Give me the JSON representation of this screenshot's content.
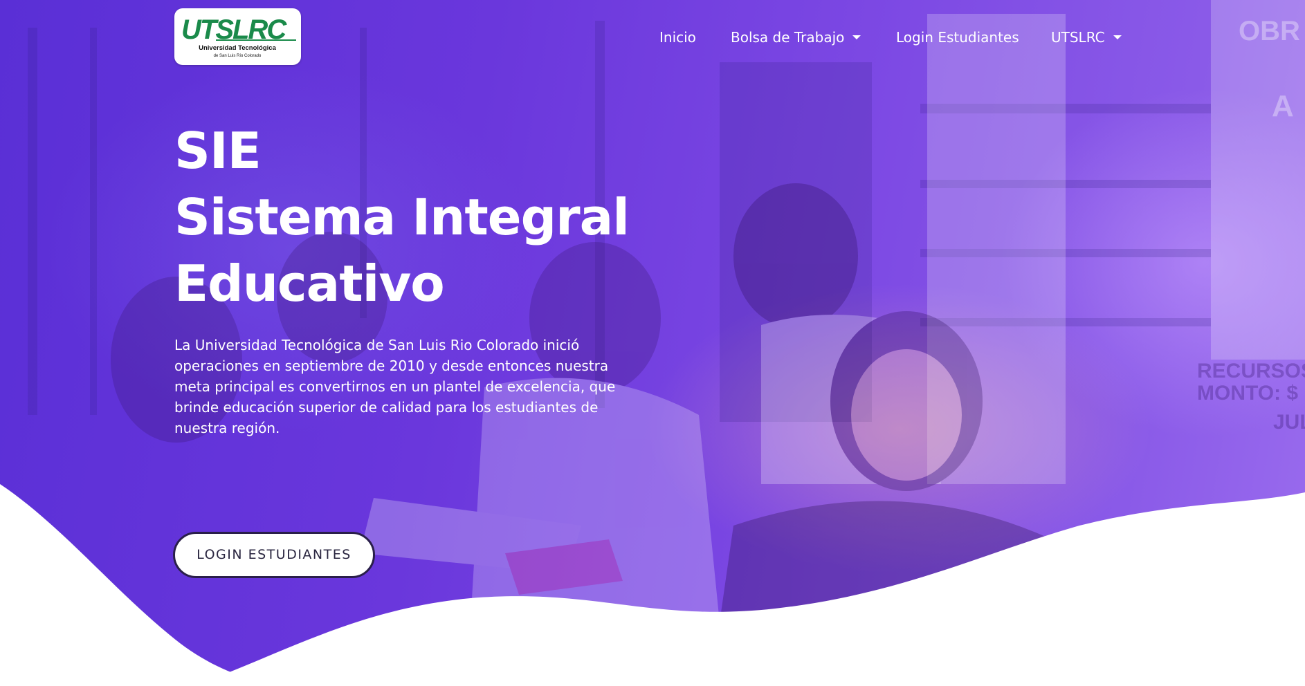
{
  "brand": {
    "logo_text": "UTSLRC",
    "logo_subtitle": "Universidad Tecnológica",
    "logo_subtitle2": "de San Luis Río Colorado"
  },
  "nav": {
    "items": [
      {
        "label": "Inicio",
        "dropdown": false
      },
      {
        "label": "Bolsa de Trabajo",
        "dropdown": true
      },
      {
        "label": "Login Estudiantes",
        "dropdown": false
      },
      {
        "label": "UTSLRC",
        "dropdown": true
      }
    ]
  },
  "hero": {
    "title_line1": "SIE",
    "title_line2": "Sistema Integral",
    "title_line3": "Educativo",
    "description": "La Universidad Tecnológica de San Luis Rio Colorado inició operaciones en septiembre de 2010 y desde entonces nuestra meta principal es convertirnos en un plantel de excelencia, que brinde educación superior de calidad para los estudiantes de nuestra región.",
    "cta_label": "LOGIN ESTUDIANTES"
  },
  "colors": {
    "hero_overlay": "#6a37dc",
    "logo_green": "#1a8a4a",
    "cta_border": "#2a1f4a"
  }
}
